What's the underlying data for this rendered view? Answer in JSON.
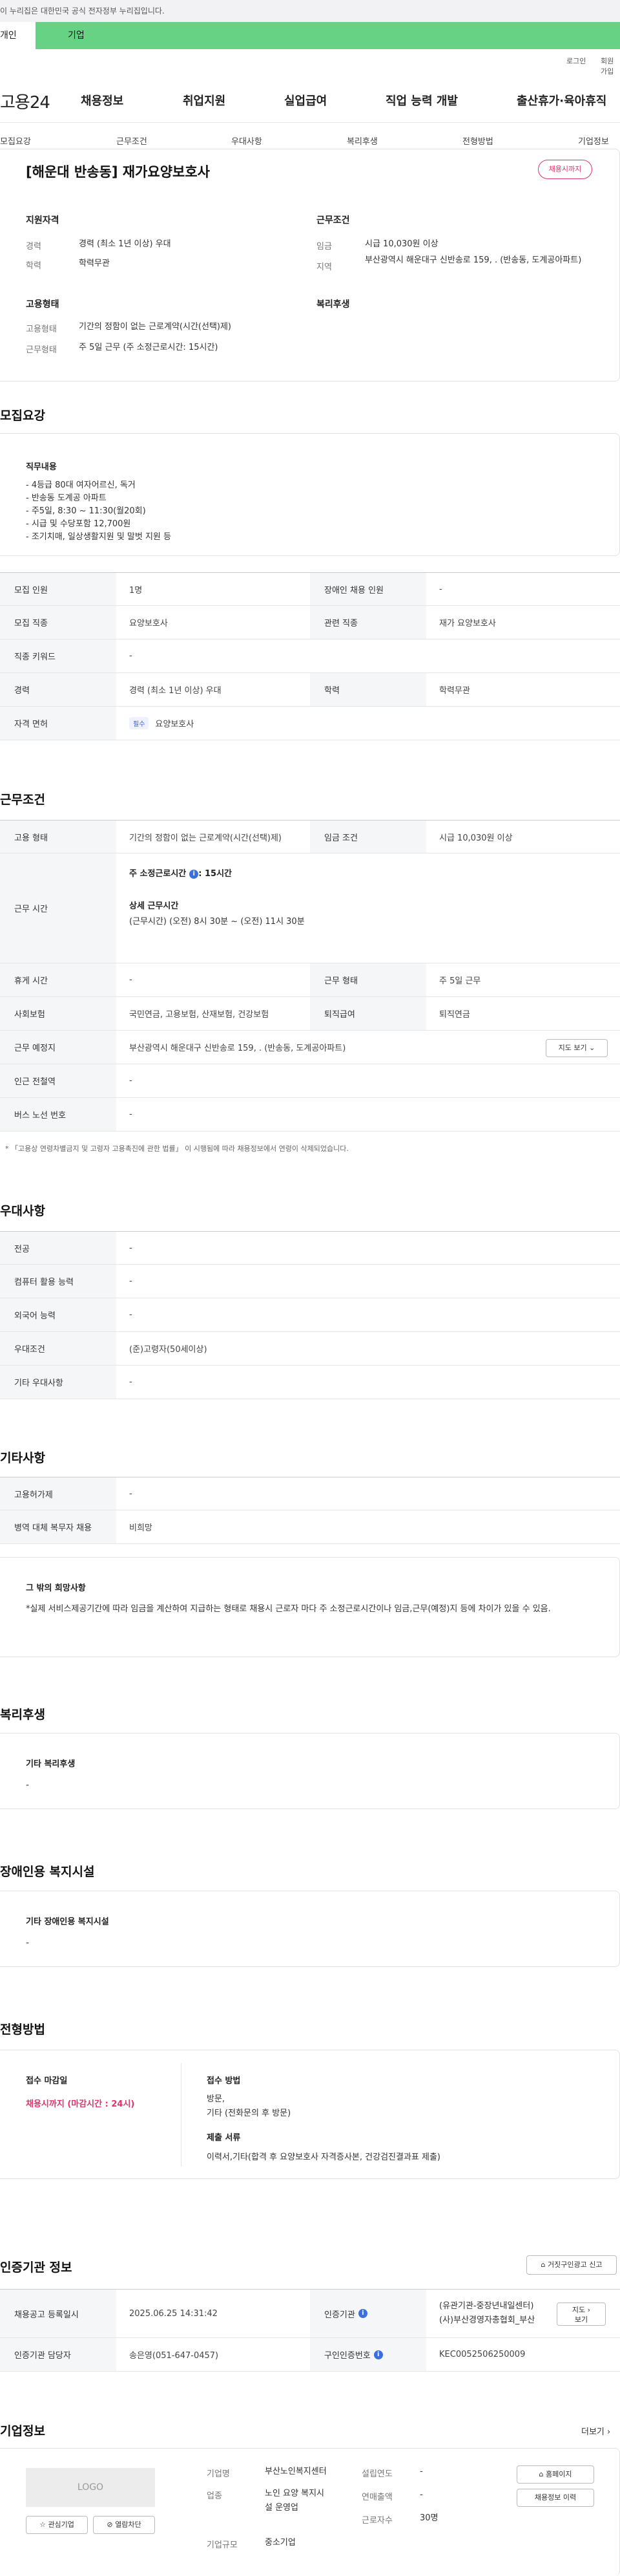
{
  "topbar": {
    "notice": "이 누리집은 대한민국 공식 전자정부 누리집입니다."
  },
  "tabs": {
    "individual": "개인",
    "business": "기업"
  },
  "util": {
    "login": "로그인",
    "join": "회원가입"
  },
  "gnb": {
    "logo": "고용24",
    "items": [
      "채용정보",
      "취업지원",
      "실업급여",
      "직업 능력 개발",
      "출산휴가·육아휴직"
    ]
  },
  "subnav": [
    "모집요강",
    "근무조건",
    "우대사항",
    "복리후생",
    "전형방법",
    "기업정보"
  ],
  "job": {
    "title": "[해운대 반송동] 재가요양보호사",
    "status_badge": "채용시까지",
    "req_heading": "지원자격",
    "req_rows": [
      {
        "label": "경력",
        "value": "경력 (최소 1년 이상) 우대"
      },
      {
        "label": "학력",
        "value": "학력무관"
      }
    ],
    "cond_heading": "근무조건",
    "cond_rows": [
      {
        "label": "임금",
        "value": "시급 10,030원 이상"
      },
      {
        "label": "지역",
        "value": "부산광역시 해운대구 신반송로 159, . (반송동, 도계공아파트)"
      }
    ],
    "emp_heading": "고용형태",
    "emp_rows": [
      {
        "label": "고용형태",
        "value": "기간의 정함이 없는 근로계약(시간(선택)제)"
      },
      {
        "label": "근무형태",
        "value": "주 5일 근무 (주 소정근로시간: 15시간)"
      }
    ],
    "welfare_heading": "복리후생"
  },
  "recruit": {
    "section_title": "모집요강",
    "duties_heading": "직무내용",
    "duties": [
      "- 4등급 80대 여자어르신, 독거",
      "- 반송동 도계공 아파트",
      "- 주5일, 8:30 ~ 11:30(월20회)",
      "- 시급 및 수당포함 12,700원",
      "- 조기치매, 일상생활지원 및 말벗 지원 등"
    ],
    "rows": [
      {
        "th1": "모집 인원",
        "td1": "1명",
        "th2": "장애인 채용 인원",
        "td2": "-"
      },
      {
        "th1": "모집 직종",
        "td1": "요양보호사",
        "th2": "관련 직종",
        "td2": "재가 요양보호사"
      },
      {
        "th1": "직종 키워드",
        "td1": "-"
      },
      {
        "th1": "경력",
        "td1": "경력 (최소 1년 이상) 우대",
        "th2": "학력",
        "td2": "학력무관"
      },
      {
        "th1": "자격 면허",
        "chip": "필수",
        "td1": "요양보호사"
      }
    ]
  },
  "conditions": {
    "section_title": "근무조건",
    "emp_type_label": "고용 형태",
    "emp_type_value": "기간의 정함이 없는 근로계약(시간(선택)제)",
    "wage_label": "임금 조건",
    "wage_value": "시급 10,030원 이상",
    "hours_label": "근무 시간",
    "hours_weekly": "주 소정근로시간",
    "hours_weekly_value": ": 15시간",
    "hours_detail_heading": "상세 근무시간",
    "hours_detail": "(근무시간) (오전) 8시 30분 ~ (오전) 11시 30분",
    "rest_label": "휴게 시간",
    "rest_value": "-",
    "workform_label": "근무 형태",
    "workform_value": "주 5일 근무",
    "insurance_label": "사회보험",
    "insurance_value": "국민연금, 고용보험, 산재보험, 건강보험",
    "retire_label": "퇴직급여",
    "retire_value": "퇴직연금",
    "place_label": "근무 예정지",
    "place_value": "부산광역시 해운대구 신반송로 159, . (반송동, 도계공아파트)",
    "map_button": "지도 보기",
    "subway_label": "인근 전철역",
    "subway_value": "-",
    "bus_label": "버스 노선 번호",
    "bus_value": "-",
    "note": "* 「고용상 연령차별금지 및 고령자 고용촉진에 관한 법률」 이 시행됨에 따라 채용정보에서 연령이 삭제되었습니다."
  },
  "preference": {
    "section_title": "우대사항",
    "rows": [
      {
        "label": "전공",
        "value": "-"
      },
      {
        "label": "컴퓨터 활용 능력",
        "value": "-"
      },
      {
        "label": "외국어 능력",
        "value": "-"
      },
      {
        "label": "우대조건",
        "value": "(준)고령자(50세이상)"
      },
      {
        "label": "기타 우대사항",
        "value": "-"
      }
    ]
  },
  "other": {
    "section_title": "기타사항",
    "rows": [
      {
        "label": "고용허가제",
        "value": "-"
      },
      {
        "label": "병역 대체 복무자 채용",
        "value": "비희망"
      }
    ],
    "extra_heading": "그 밖의 희망사항",
    "extra_text": "*실제 서비스제공기간에 따라 임금을 계산하여 지급하는 형태로 채용시 근로자 마다 주 소정근로시간이나 임금,근무(예정)지 등에 차이가 있을 수 있음."
  },
  "welfare": {
    "section_title": "복리후생",
    "heading": "기타 복리후생",
    "value": "-"
  },
  "disability": {
    "section_title": "장애인용 복지시설",
    "heading": "기타 장애인용 복지시설",
    "value": "-"
  },
  "selection": {
    "section_title": "전형방법",
    "deadline_heading": "접수 마감일",
    "deadline_value": "채용시까지 (마감시간 : 24시)",
    "method_heading": "접수 방법",
    "method_values": [
      "방문,",
      "기타 (전화문의 후 방문)"
    ],
    "docs_heading": "제출 서류",
    "docs_value": "이력서,기타(합격 후 요양보호사 자격증사본, 건강검진결과표 제출)"
  },
  "certification": {
    "section_title": "인증기관 정보",
    "report_button": "거짓구인광고 신고",
    "reg_label": "채용공고 등록일시",
    "reg_value": "2025.06.25 14:31:42",
    "org_label": "인증기관",
    "org_values": [
      "(유관기관-중장년내일센터)",
      "(사)부산경영자총협회_부산"
    ],
    "map_button": [
      "지도",
      "보기"
    ],
    "manager_label": "인증기관 담당자",
    "manager_value": "송은영(051-647-0457)",
    "cert_no_label": "구인인증번호",
    "cert_no_value": "KEC0052506250009"
  },
  "company": {
    "section_title": "기업정보",
    "more": "더보기",
    "logo_text": "LOGO",
    "fav_button": "관심기업",
    "block_button": "열람차단",
    "name_label": "기업명",
    "name_value": "부산노인복지센터",
    "industry_label": "업종",
    "industry_value": [
      "노인 요양 복지시",
      "설 운영업"
    ],
    "size_label": "기업규모",
    "size_value": "중소기업",
    "founded_label": "설립연도",
    "founded_value": "-",
    "sales_label": "연매출액",
    "sales_value": "-",
    "staff_label": "근로자수",
    "staff_value": "30명",
    "homepage_button": "홈페이지",
    "history_button": "채용정보 이력"
  }
}
